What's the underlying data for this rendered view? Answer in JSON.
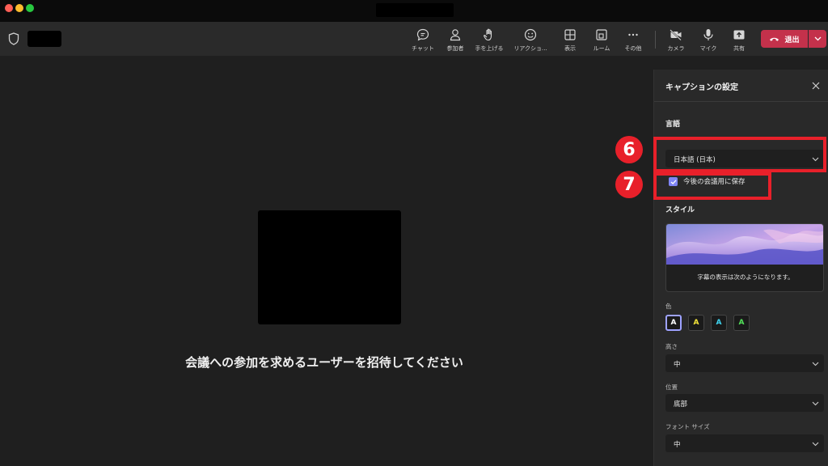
{
  "toolbar": {
    "items": [
      {
        "label": "チャット",
        "icon": "chat-icon"
      },
      {
        "label": "参加者",
        "icon": "people-icon"
      },
      {
        "label": "手を上げる",
        "icon": "raise-hand-icon"
      },
      {
        "label": "リアクショ...",
        "icon": "reaction-icon"
      },
      {
        "label": "表示",
        "icon": "view-icon"
      },
      {
        "label": "ルーム",
        "icon": "rooms-icon"
      },
      {
        "label": "その他",
        "icon": "more-icon"
      },
      {
        "label": "カメラ",
        "icon": "camera-off-icon"
      },
      {
        "label": "マイク",
        "icon": "mic-icon"
      },
      {
        "label": "共有",
        "icon": "share-icon"
      }
    ],
    "leave_label": "退出"
  },
  "stage": {
    "invite_text": "会議への参加を求めるユーザーを招待してください"
  },
  "panel": {
    "title": "キャプションの設定",
    "language_section": "言語",
    "language_value": "日本語 (日本)",
    "save_checkbox_label": "今後の会議用に保存",
    "style_section": "スタイル",
    "preview_text": "字幕の表示は次のようになります。",
    "color_label": "色",
    "swatches": [
      {
        "letter": "A",
        "color": "#ffffff"
      },
      {
        "letter": "A",
        "color": "#f2e33a"
      },
      {
        "letter": "A",
        "color": "#3fd4f0"
      },
      {
        "letter": "A",
        "color": "#52e05a"
      }
    ],
    "height_label": "高さ",
    "height_value": "中",
    "position_label": "位置",
    "position_value": "底部",
    "font_size_label": "フォント サイズ",
    "font_size_value": "中"
  },
  "annotations": {
    "badge_6": "6",
    "badge_7": "7"
  },
  "colors": {
    "accent": "#7f85f5",
    "leave": "#c4314b",
    "callout": "#e8202a"
  }
}
